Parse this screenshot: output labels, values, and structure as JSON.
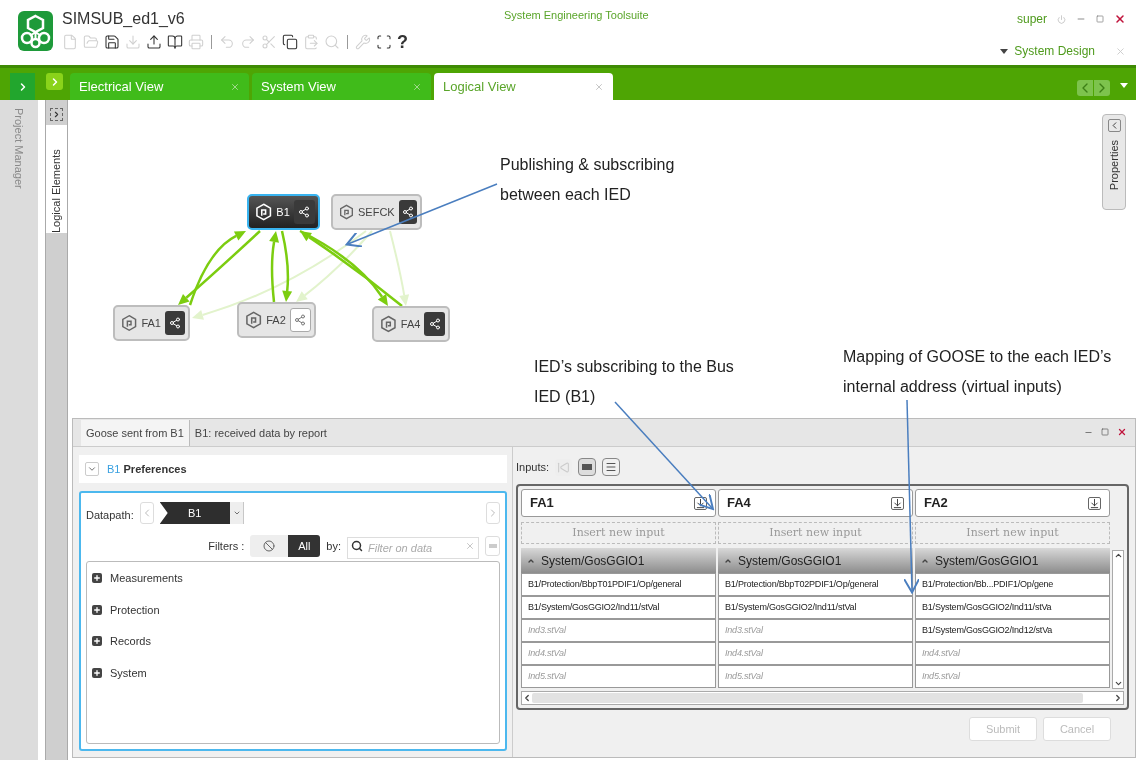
{
  "app": {
    "title": "SIMSUB_ed1_v6",
    "suite": "System Engineering Toolsuite",
    "user": "super",
    "workspace": "System Design"
  },
  "toolbar": [
    {
      "kind": "new",
      "disabled": true
    },
    {
      "kind": "open",
      "disabled": true
    },
    {
      "kind": "save",
      "disabled": false
    },
    {
      "kind": "download",
      "disabled": true
    },
    {
      "kind": "upload",
      "disabled": false
    },
    {
      "kind": "book",
      "disabled": false
    },
    {
      "kind": "print",
      "disabled": true
    },
    {
      "kind": "separator"
    },
    {
      "kind": "undo",
      "disabled": true
    },
    {
      "kind": "redo",
      "disabled": true
    },
    {
      "kind": "cut",
      "disabled": true
    },
    {
      "kind": "copy",
      "disabled": false
    },
    {
      "kind": "paste",
      "disabled": true
    },
    {
      "kind": "find",
      "disabled": true
    },
    {
      "kind": "separator"
    },
    {
      "kind": "tools",
      "disabled": true
    },
    {
      "kind": "fullscreen",
      "disabled": false
    },
    {
      "kind": "help",
      "disabled": false,
      "label": "?"
    }
  ],
  "tabs": [
    {
      "label": "Electrical View",
      "selected": false
    },
    {
      "label": "System View",
      "selected": false
    },
    {
      "label": "Logical View",
      "selected": true
    }
  ],
  "side_panels": {
    "project": "Project Manager",
    "elements": "Logical Elements",
    "properties": "Properties"
  },
  "nodes": [
    {
      "label": "B1",
      "selected": true,
      "share_active": true
    },
    {
      "label": "SEFCK",
      "selected": false,
      "share_active": true
    },
    {
      "label": "FA1",
      "selected": false,
      "share_active": true
    },
    {
      "label": "FA2",
      "selected": false,
      "share_active": false
    },
    {
      "label": "FA4",
      "selected": false,
      "share_active": true
    }
  ],
  "annotations": [
    "Publishing & subscribing between each IED",
    "IED’s subscribing to the Bus IED (B1)",
    "Mapping of GOOSE to the each IED’s internal address (virtual inputs)"
  ],
  "panel": {
    "tabs": [
      {
        "label": "Goose sent from B1",
        "selected": true
      },
      {
        "label": "B1: received data by report",
        "selected": false
      }
    ],
    "preferences": {
      "device": "B1",
      "title": "Preferences",
      "expanded": true
    },
    "datapath_label": "Datapath:",
    "datapath_value": "B1",
    "filters_label": "Filters :",
    "filter_all": "All",
    "by_label": "by:",
    "filter_placeholder": "Filter on data",
    "tree": [
      {
        "label": "Measurements",
        "expanded": false
      },
      {
        "label": "Protection",
        "expanded": false
      },
      {
        "label": "Records",
        "expanded": false
      },
      {
        "label": "System",
        "expanded": false
      }
    ],
    "inputs_label": "Inputs:",
    "columns": [
      {
        "name": "FA1",
        "insert": "Insert new input",
        "group": "System/GosGGIO1",
        "rows": [
          {
            "text": "B1/Protection/BbpT01PDIF1/Op/general",
            "kind": "mapped"
          },
          {
            "text": "B1/System/GosGGIO2/Ind11/stVal",
            "kind": "mapped"
          },
          {
            "text": "Ind3.stVal",
            "kind": "free"
          },
          {
            "text": "Ind4.stVal",
            "kind": "free"
          },
          {
            "text": "Ind5.stVal",
            "kind": "free"
          }
        ]
      },
      {
        "name": "FA4",
        "insert": "Insert new input",
        "group": "System/GosGGIO1",
        "rows": [
          {
            "text": "B1/Protection/BbpT02PDIF1/Op/general",
            "kind": "mapped"
          },
          {
            "text": "B1/System/GosGGIO2/Ind11/stVal",
            "kind": "mapped"
          },
          {
            "text": "Ind3.stVal",
            "kind": "free"
          },
          {
            "text": "Ind4.stVal",
            "kind": "free"
          },
          {
            "text": "Ind5.stVal",
            "kind": "free"
          }
        ]
      },
      {
        "name": "FA2",
        "insert": "Insert new input",
        "group": "System/GosGGIO1",
        "rows": [
          {
            "text": "B1/Protection/Bb...PDIF1/Op/gene",
            "kind": "mapped"
          },
          {
            "text": "B1/System/GosGGIO2/Ind11/stVa",
            "kind": "mapped"
          },
          {
            "text": "B1/System/GosGGIO2/Ind12/stVa",
            "kind": "mapped"
          },
          {
            "text": "Ind4.stVal",
            "kind": "free"
          },
          {
            "text": "Ind5.stVal",
            "kind": "free"
          }
        ]
      }
    ],
    "buttons": [
      {
        "label": "Submit",
        "disabled": true
      },
      {
        "label": "Cancel",
        "disabled": true
      }
    ]
  }
}
